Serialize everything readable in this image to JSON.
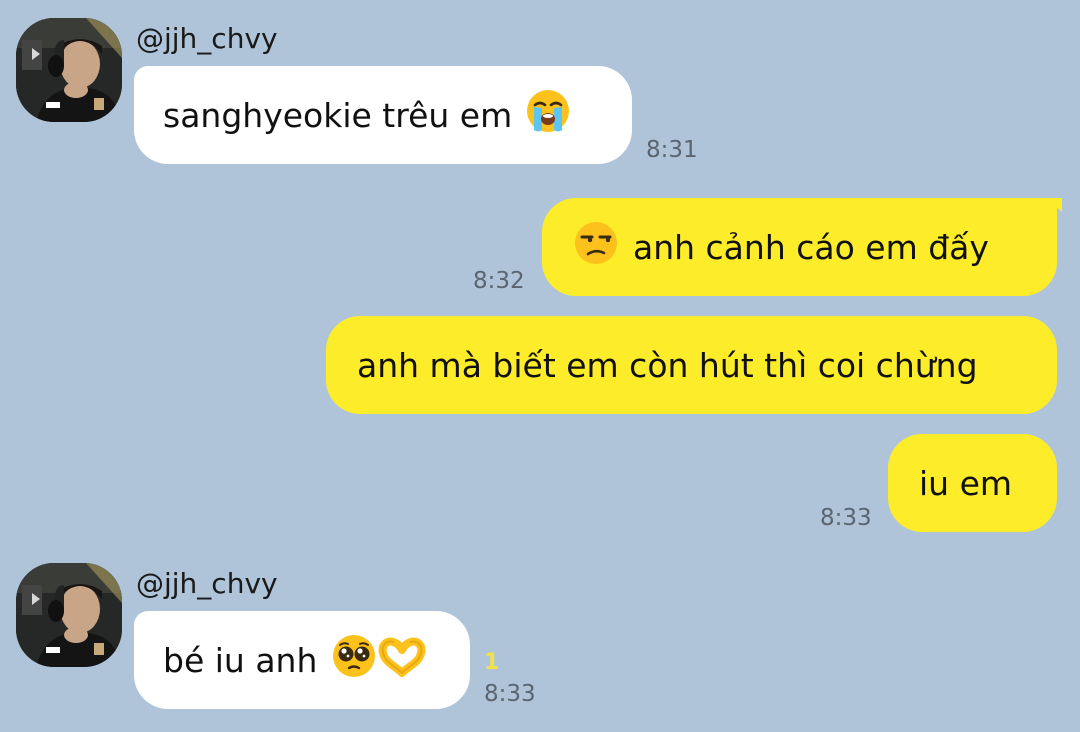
{
  "chat": {
    "messages": [
      {
        "sender": "@jjh_chvy",
        "text": "sanghyeokie trêu em",
        "emoji_icons": [
          "loudly-crying-face-icon"
        ],
        "time": "8:31"
      },
      {
        "sender": "me",
        "text": "anh cảnh cáo em đấy",
        "emoji_icons": [
          "unamused-face-icon"
        ],
        "time": "8:32"
      },
      {
        "sender": "me",
        "text": "anh mà biết em còn hút thì coi chừng"
      },
      {
        "sender": "me",
        "text": "iu em",
        "time": "8:33"
      },
      {
        "sender": "@jjh_chvy",
        "text": "bé iu anh",
        "emoji_icons": [
          "pleading-face-icon",
          "heart-hands-icon"
        ],
        "unread_count": "1",
        "time": "8:33"
      }
    ]
  },
  "colors": {
    "background": "#afc4d9",
    "incoming_bubble": "#ffffff",
    "outgoing_bubble": "#fdec2a",
    "unread_count": "#f1e14a",
    "timestamp": "#5a6570"
  }
}
